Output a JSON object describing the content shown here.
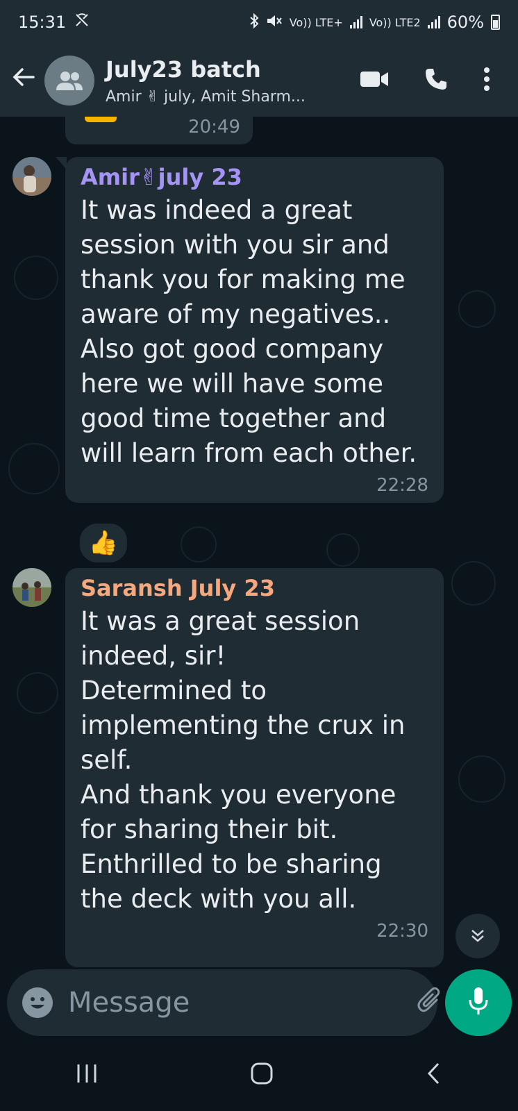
{
  "status_bar": {
    "time": "15:31",
    "network_1": "Vo)) LTE+",
    "network_2": "Vo)) LTE2",
    "battery": "60%"
  },
  "header": {
    "title": "July23 batch",
    "subtitle": "Amir ✌ july, Amit Sharm..."
  },
  "messages": [
    {
      "time": "20:49",
      "partial": true
    },
    {
      "sender": "Amir✌july 23",
      "sender_color": "#a694f5",
      "text": "It was indeed a great session with you sir and thank you for making me aware of my negatives..\nAlso got good company here we will have some good time together and will learn from each other.",
      "time": "22:28",
      "reaction": "👍"
    },
    {
      "sender": "Saransh July 23",
      "sender_color": "#f5a87d",
      "text": "It was a great session indeed, sir!\nDetermined to implementing the crux in self.\nAnd thank you everyone for sharing their bit.\nEnthrilled to be sharing the deck with you all.",
      "time": "22:30"
    }
  ],
  "composer": {
    "placeholder": "Message"
  },
  "icons": {
    "back": "back-arrow-icon",
    "video": "video-call-icon",
    "voice": "voice-call-icon",
    "menu": "more-options-icon",
    "emoji": "emoji-icon",
    "attach": "attach-icon",
    "camera": "camera-icon",
    "mic": "mic-icon",
    "scroll": "scroll-down-icon"
  },
  "colors": {
    "accent": "#00a884",
    "header_bg": "#1f2c34",
    "bubble_bg": "#202c33",
    "chat_bg": "#0b141a"
  }
}
